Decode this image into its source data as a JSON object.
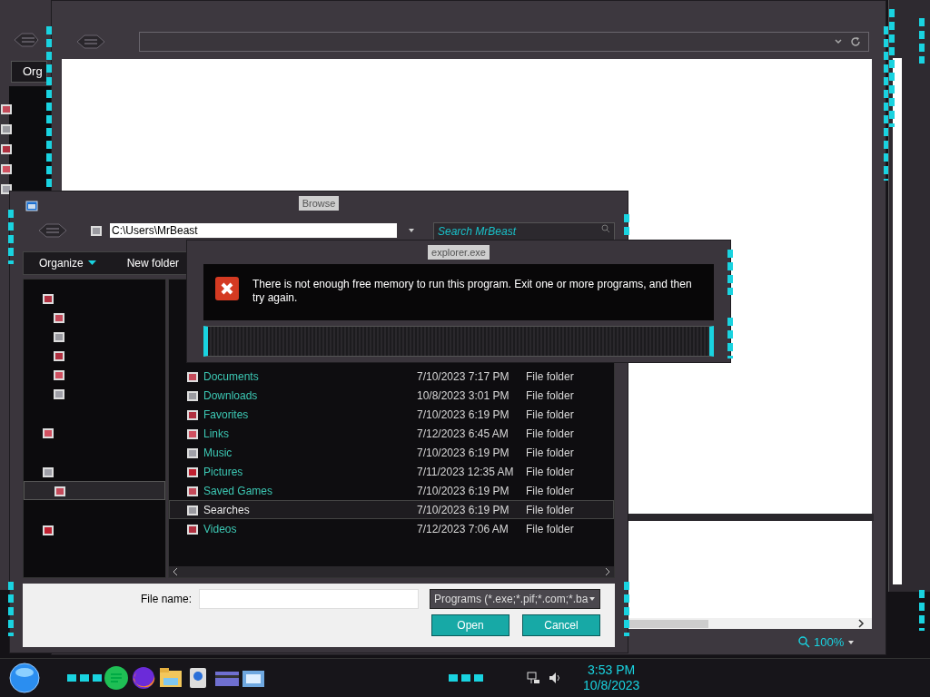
{
  "left_window": {
    "button": "Org"
  },
  "browser_window": {
    "zoom": "100%"
  },
  "browse_dialog": {
    "title": "Browse",
    "address": "C:\\Users\\MrBeast",
    "search": {
      "placeholder": "Search MrBeast"
    },
    "toolbar": [
      "Organize",
      "New folder"
    ],
    "nav_items": [
      {
        "selected": false,
        "children": [
          {
            "selected": false
          },
          {
            "selected": false
          },
          {
            "selected": false
          },
          {
            "selected": false
          },
          {
            "selected": false
          }
        ]
      },
      {
        "selected": false
      },
      {
        "selected": false,
        "children": [
          {
            "selected": true
          }
        ]
      },
      {
        "selected": false
      }
    ],
    "files": [
      {
        "name": "Documents",
        "date": "7/10/2023 7:17 PM",
        "type": "File folder",
        "selected": false
      },
      {
        "name": "Downloads",
        "date": "10/8/2023 3:01 PM",
        "type": "File folder",
        "selected": false
      },
      {
        "name": "Favorites",
        "date": "7/10/2023 6:19 PM",
        "type": "File folder",
        "selected": false
      },
      {
        "name": "Links",
        "date": "7/12/2023 6:45 AM",
        "type": "File folder",
        "selected": false
      },
      {
        "name": "Music",
        "date": "7/10/2023 6:19 PM",
        "type": "File folder",
        "selected": false
      },
      {
        "name": "Pictures",
        "date": "7/11/2023 12:35 AM",
        "type": "File folder",
        "selected": false
      },
      {
        "name": "Saved Games",
        "date": "7/10/2023 6:19 PM",
        "type": "File folder",
        "selected": false
      },
      {
        "name": "Searches",
        "date": "7/10/2023 6:19 PM",
        "type": "File folder",
        "selected": true
      },
      {
        "name": "Videos",
        "date": "7/12/2023 7:06 AM",
        "type": "File folder",
        "selected": false
      }
    ],
    "file_name": {
      "label": "File name:"
    },
    "file_type": "Programs (*.exe;*.pif;*.com;*.ba",
    "buttons": [
      "Open",
      "Cancel"
    ]
  },
  "error_dialog": {
    "title": "explorer.exe",
    "message": "There is not enough free memory to run this program. Exit one or more programs, and then try again."
  },
  "taskbar": {
    "time": "3:53 PM",
    "date": "10/8/2023"
  }
}
